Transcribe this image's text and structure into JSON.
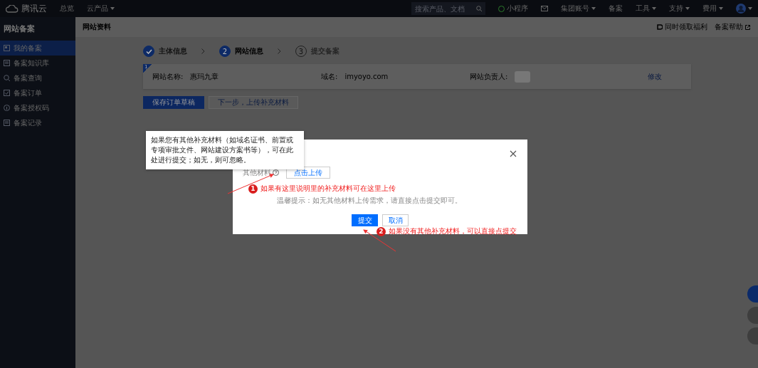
{
  "topbar": {
    "logo": "腾讯云",
    "nav": [
      {
        "label": "总览",
        "dropdown": false
      },
      {
        "label": "云产品",
        "dropdown": true
      }
    ],
    "search": {
      "placeholder": "搜索产品、文档"
    },
    "right": [
      {
        "kind": "app",
        "label": "小程序",
        "dropdown": false
      },
      {
        "kind": "mail"
      },
      {
        "kind": "text",
        "label": "集团账号",
        "dropdown": true
      },
      {
        "kind": "text",
        "label": "备案",
        "dropdown": false
      },
      {
        "kind": "text",
        "label": "工具",
        "dropdown": true
      },
      {
        "kind": "text",
        "label": "支持",
        "dropdown": true
      },
      {
        "kind": "text",
        "label": "费用",
        "dropdown": true
      },
      {
        "kind": "avatar",
        "dropdown": true
      }
    ]
  },
  "sidebar": {
    "title": "网站备案",
    "items": [
      {
        "label": "我的备案",
        "selected": true
      },
      {
        "label": "备案知识库",
        "selected": false
      },
      {
        "label": "备案查询",
        "selected": false
      },
      {
        "label": "备案订单",
        "selected": false
      },
      {
        "label": "备案授权码",
        "selected": false
      },
      {
        "label": "备案记录",
        "selected": false
      }
    ]
  },
  "header": {
    "title": "网站资料",
    "links": [
      "同时领取福利",
      "备案帮助"
    ]
  },
  "steps": [
    {
      "label": "主体信息",
      "completed": true,
      "selected": false
    },
    {
      "number": "2",
      "label": "网站信息",
      "completed": false,
      "selected": true
    },
    {
      "number": "3",
      "label": "提交备案",
      "completed": false,
      "selected": false
    }
  ],
  "card": {
    "corner": "1",
    "fields": [
      {
        "label": "网站名称:",
        "value": "惠玛九章"
      },
      {
        "label": "域名:",
        "value": "imyoyo.com"
      },
      {
        "label": "网站负责人:",
        "value_hidden": true
      }
    ],
    "link": "修改"
  },
  "actions": [
    {
      "label": "保存订单草稿",
      "primary": true
    },
    {
      "label": "下一步，上传补充材料",
      "primary": false
    }
  ],
  "tooltip": "如果您有其他补充材料（如域名证书、前置或专项审批文件、网站建设方案书等），可在此处进行提交；如无，则可忽略。",
  "modal": {
    "label": "其他材料",
    "upload": "点击上传",
    "hint": "温馨提示：如无其他材料上传需求，请直接点击提交即可。",
    "buttons": [
      {
        "label": "提交",
        "primary": true
      },
      {
        "label": "取消",
        "primary": false
      }
    ]
  },
  "annotations": [
    {
      "number": "1",
      "text": "如果有这里说明里的补充材料可在这里上传"
    },
    {
      "number": "2",
      "text": "如果没有其他补充材料，可以直接点提交"
    }
  ]
}
